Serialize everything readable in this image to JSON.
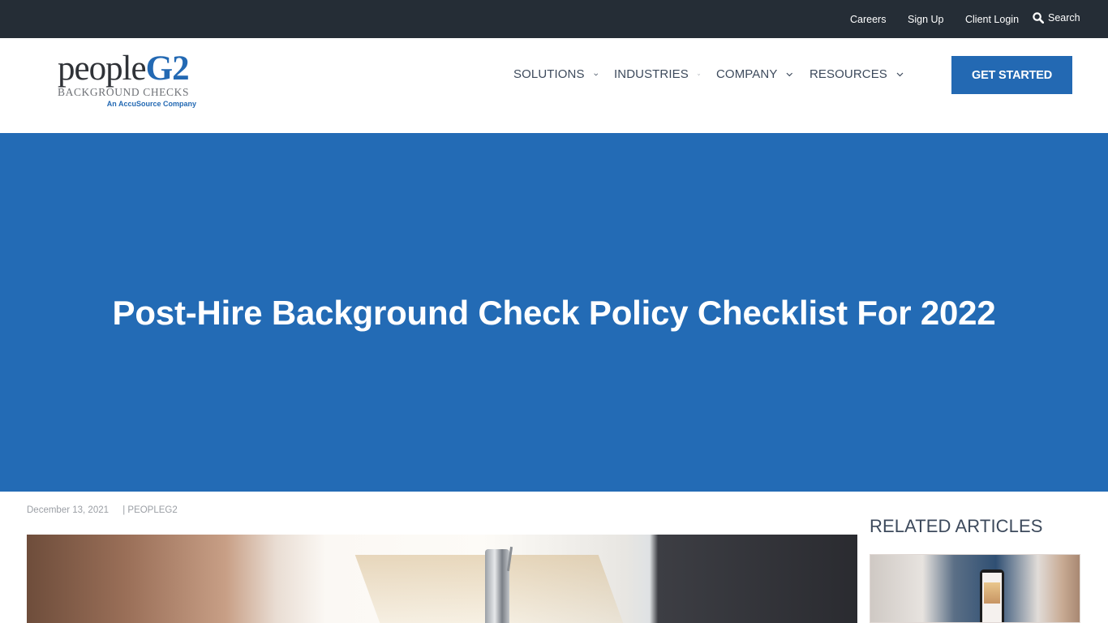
{
  "topbar": {
    "links": [
      "Careers",
      "Sign Up",
      "Client Login"
    ],
    "search_label": "Search"
  },
  "header": {
    "logo": {
      "word_main": "people",
      "word_accent": "G2",
      "tagline": "BACKGROUND CHECKS",
      "company": "An AccuSource Company"
    },
    "nav": [
      {
        "label": "SOLUTIONS",
        "icon": "chevron-down-icon"
      },
      {
        "label": "INDUSTRIES",
        "icon": "chevron-down-icon"
      },
      {
        "label": "COMPANY",
        "icon": "chevron-down-icon"
      },
      {
        "label": "RESOURCES",
        "icon": "chevron-down-icon"
      }
    ],
    "cta_label": "GET STARTED"
  },
  "hero": {
    "title": "Post-Hire Background Check Policy Checklist For 2022"
  },
  "post": {
    "date": "December 13, 2021",
    "author": "| PEOPLEG2"
  },
  "sidebar": {
    "title": "RELATED ARTICLES"
  },
  "colors": {
    "brand_blue": "#2369b3",
    "topbar_bg": "#252d36",
    "nav_text": "#3d4a5c"
  }
}
